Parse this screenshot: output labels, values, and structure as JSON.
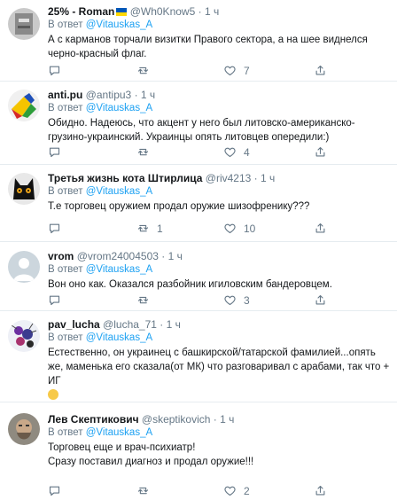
{
  "tweets": [
    {
      "name": "25% - Roman",
      "handle": "@Wh0Know5",
      "time": "1 ч",
      "reply_prefix": "В ответ",
      "reply_to": "@Vitauskas_A",
      "text": "А с карманов торчали визитки Правого сектора, а на шее виднелся черно-красный флаг.",
      "retweets": "",
      "likes": "7",
      "replies": ""
    },
    {
      "name": "anti.pu",
      "handle": "@antipu3",
      "time": "1 ч",
      "reply_prefix": "В ответ",
      "reply_to": "@Vitauskas_A",
      "text": "Обидно. Надеюсь, что акцент у него был литовско-американско-грузино-украинский. Украинцы опять литовцев опередили:)",
      "retweets": "",
      "likes": "4",
      "replies": ""
    },
    {
      "name": "Третья жизнь кота Штирлица",
      "handle": "@riv4213",
      "time": "1 ч",
      "reply_prefix": "В ответ",
      "reply_to": "@Vitauskas_A",
      "text": "Т.е торговец оружием продал оружие шизофренику???",
      "retweets": "1",
      "likes": "10",
      "replies": ""
    },
    {
      "name": "vrom",
      "handle": "@vrom24004503",
      "time": "1 ч",
      "reply_prefix": "В ответ",
      "reply_to": "@Vitauskas_A",
      "text": "Вон оно как. Оказался разбойник игиловским бандеровцем.",
      "retweets": "",
      "likes": "3",
      "replies": ""
    },
    {
      "name": "pav_lucha",
      "handle": "@lucha_71",
      "time": "1 ч",
      "reply_prefix": "В ответ",
      "reply_to": "@Vitauskas_A",
      "text": "Естественно, он украинец с башкирской/татарской фамилией...опять же, маменька его сказала(от МК) что разговаривал с арабами, так что + ИГ",
      "retweets": "",
      "likes": "",
      "replies": ""
    },
    {
      "name": "Лев Скептикович",
      "handle": "@skeptikovich",
      "time": "1 ч",
      "reply_prefix": "В ответ",
      "reply_to": "@Vitauskas_A",
      "text": "Торговец еще и врач-психиатр!\nСразу поставил диагноз и продал оружие!!!",
      "retweets": "",
      "likes": "2",
      "replies": ""
    }
  ],
  "icons": {
    "reply": "reply-icon",
    "retweet": "retweet-icon",
    "like": "heart-icon",
    "share": "share-icon"
  },
  "colors": {
    "accent": "#1da1f2",
    "muted": "#657786",
    "border": "#e6ecf0"
  }
}
